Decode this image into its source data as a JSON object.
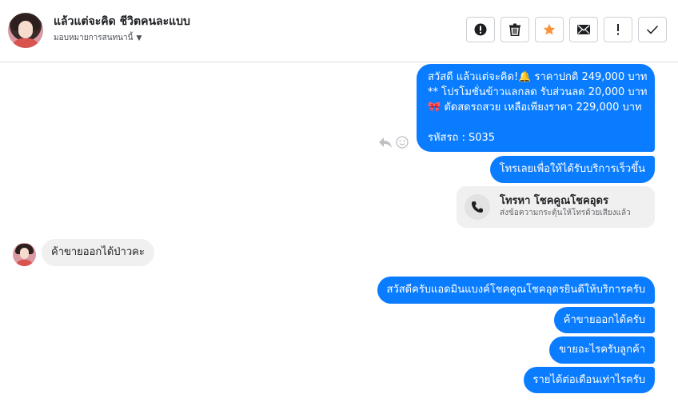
{
  "header": {
    "title": "แล้วแต่จะคิด ชีวิตคนละแบบ",
    "assign_label": "มอบหมายการสนทนานี้",
    "buttons": [
      {
        "icon": "alert-circle-icon"
      },
      {
        "icon": "trash-icon"
      },
      {
        "icon": "star-icon",
        "color": "#f7923a"
      },
      {
        "icon": "mail-icon"
      },
      {
        "icon": "exclamation-icon"
      },
      {
        "icon": "check-icon"
      }
    ]
  },
  "messages": {
    "promo_lines": "สวัสดี แล้วแต่จะคิด!🔔 ราคาปกติ 249,000 บาท\n** โปรโมชั่นข้าวแลกลด รับส่วนลด 20,000 บาท\n🎀 ตัดสดรถสวย เหลือเพียงราคา 229,000 บาท\n\nรหัสรถ : S035",
    "call_prompt": "โทรเลยเพื่อให้ได้รับบริการเร็วขึ้น",
    "call_card": {
      "title": "โทรหา โชคคูณโชคอุดร",
      "subtitle": "ส่งข้อความกระตุ้นให้โทรด้วยเสียงแล้ว"
    },
    "customer_question": "ค้าขายออกได้ป่าวคะ",
    "reply_1": "สวัสดีครับแอดมินแบงค์โชคคูณโชคอุดรยินดีให้บริการครับ",
    "reply_2": "ค้าขายออกได้ครับ",
    "reply_3": "ขายอะไรครับลูกค้า",
    "reply_4": "รายได้ต่อเดือนเท่าไรครับ"
  },
  "colors": {
    "outgoing_bubble": "#0a7cff",
    "incoming_bubble": "#f0f0f0",
    "star": "#f7923a"
  }
}
